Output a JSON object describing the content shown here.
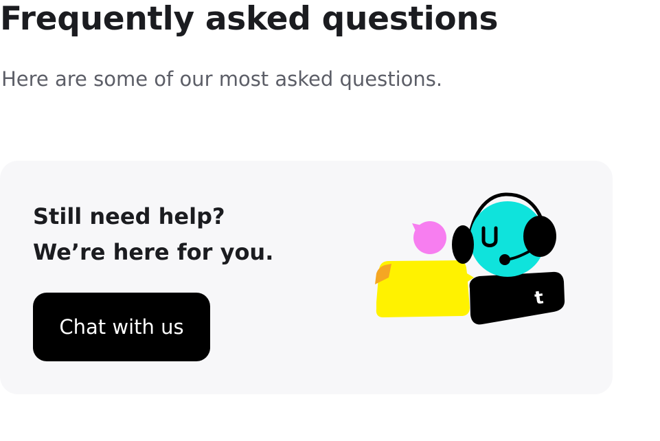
{
  "header": {
    "title": "Frequently asked questions",
    "subtitle": "Here are some of our most asked questions."
  },
  "help_card": {
    "heading_line1": "Still need help?",
    "heading_line2": "We’re here for you.",
    "chat_button_label": "Chat with us",
    "illustration": {
      "icon": "support-agent-illustration",
      "badge_letter": "t",
      "colors": {
        "agent_face": "#0fe3dc",
        "headset": "#000000",
        "speech_bubble_small": "#f77ef0",
        "speech_bubble_large": "#fff200",
        "bubble_corner": "#f5a623",
        "badge": "#000000"
      }
    }
  }
}
